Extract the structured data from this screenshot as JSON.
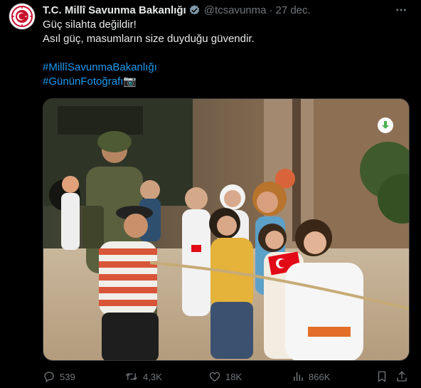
{
  "author": {
    "display_name": "T.C. Millî Savunma Bakanlığı",
    "handle": "@tcsavunma",
    "separator": "·",
    "time": "27 dec.",
    "verified_icon": "verified-badge-icon",
    "avatar_icon": "ministry-emblem-icon"
  },
  "tweet": {
    "line1": "Güç silahta değildir!",
    "line2": "Asıl güç, masumların size duyduğu güvendir.",
    "hashtag1": "#MillîSavunmaBakanlığı",
    "hashtag2": "#GününFotoğrafı📷"
  },
  "media": {
    "description_icon": "photo-children-tug-of-war",
    "badge_icon": "download-arrow-icon",
    "badge_color": "#4caf50"
  },
  "actions": {
    "replies": "539",
    "reposts": "4,3K",
    "likes": "18K",
    "views": "866K"
  },
  "colors": {
    "background": "#000000",
    "text": "#e7e9ea",
    "muted": "#71767b",
    "link": "#1d9bf0",
    "verified": "#829aab"
  }
}
